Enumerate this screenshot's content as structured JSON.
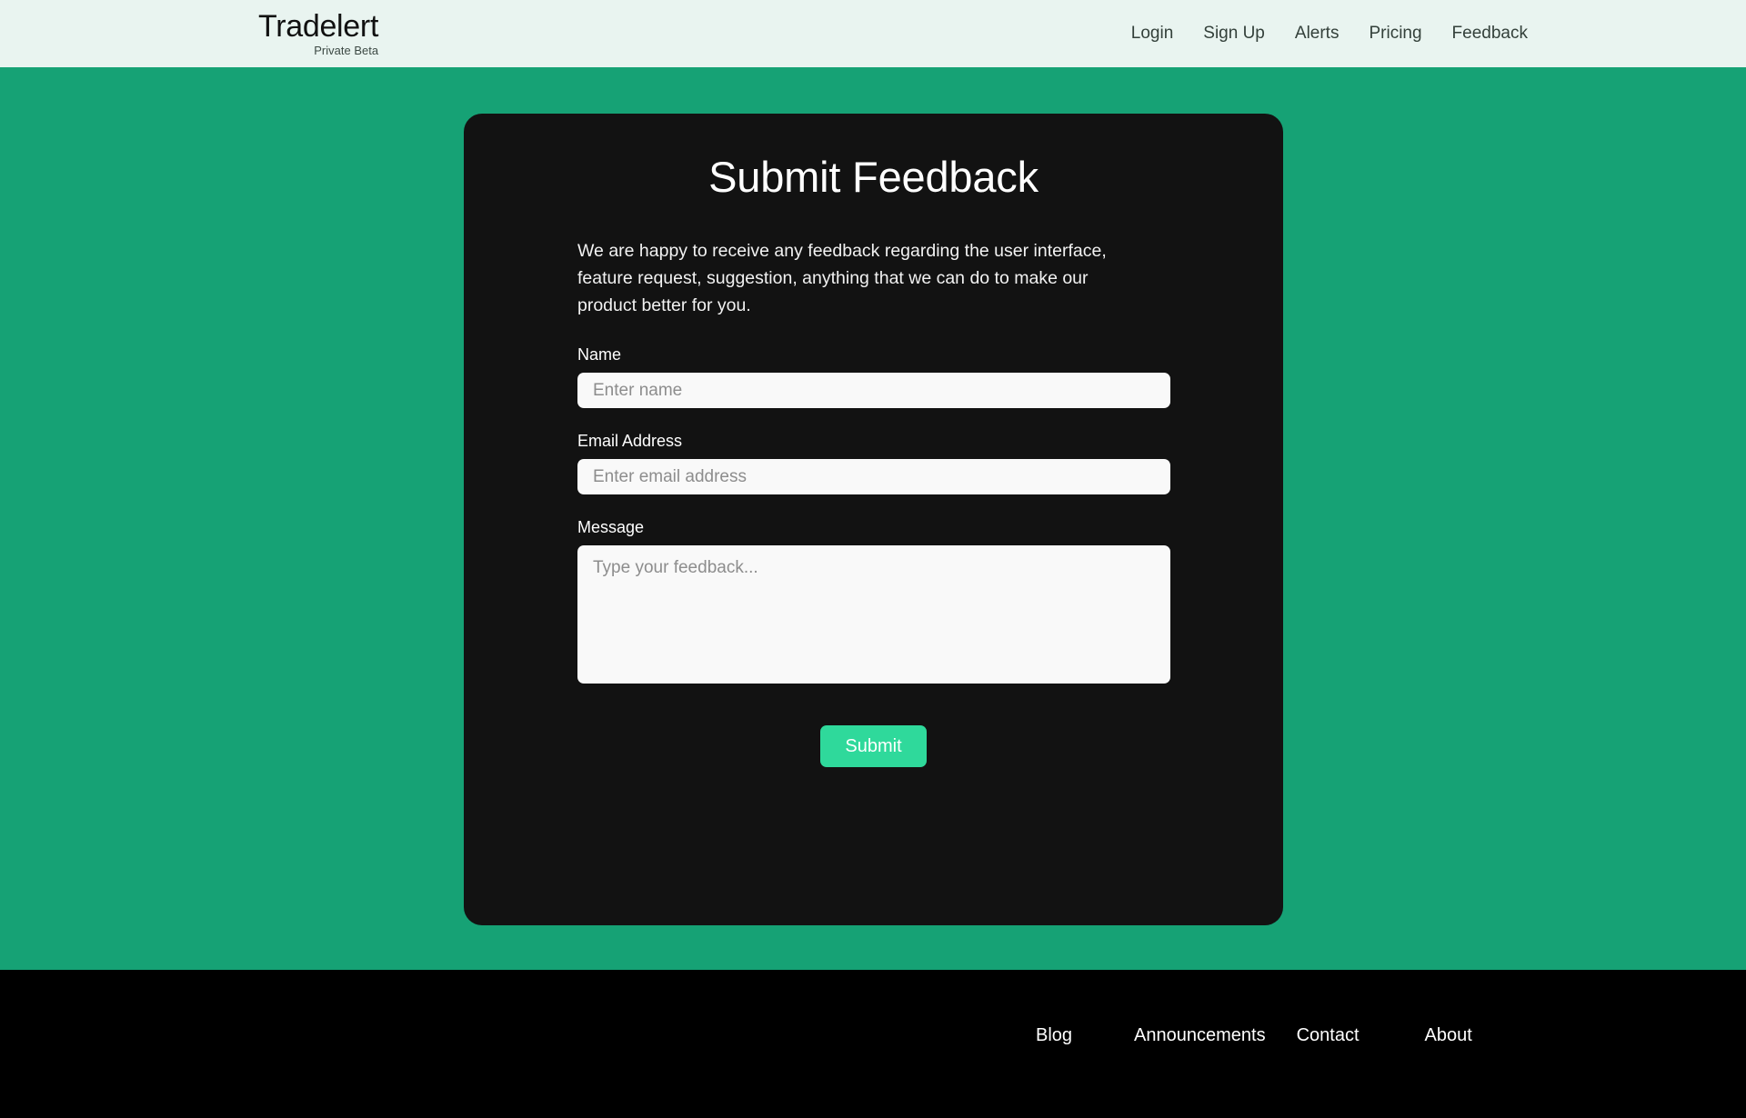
{
  "header": {
    "brand": {
      "name": "Tradelert",
      "subtitle": "Private Beta"
    },
    "nav": [
      {
        "label": "Login"
      },
      {
        "label": "Sign Up"
      },
      {
        "label": "Alerts"
      },
      {
        "label": "Pricing"
      },
      {
        "label": "Feedback"
      }
    ]
  },
  "card": {
    "title": "Submit Feedback",
    "description": "We are happy to receive any feedback regarding the user interface, feature request, suggestion, anything that we can do to make our product better for you.",
    "fields": {
      "name": {
        "label": "Name",
        "placeholder": "Enter name",
        "value": ""
      },
      "email": {
        "label": "Email Address",
        "placeholder": "Enter email address",
        "value": ""
      },
      "message": {
        "label": "Message",
        "placeholder": "Type your feedback...",
        "value": ""
      }
    },
    "submit_label": "Submit"
  },
  "footer": {
    "links": [
      {
        "label": "Blog"
      },
      {
        "label": "Announcements"
      },
      {
        "label": "Contact"
      },
      {
        "label": "About"
      }
    ]
  },
  "colors": {
    "page_background": "#16a275",
    "header_background": "#e9f4f0",
    "card_background": "#121212",
    "accent": "#2fd99b",
    "footer_background": "#000000"
  }
}
